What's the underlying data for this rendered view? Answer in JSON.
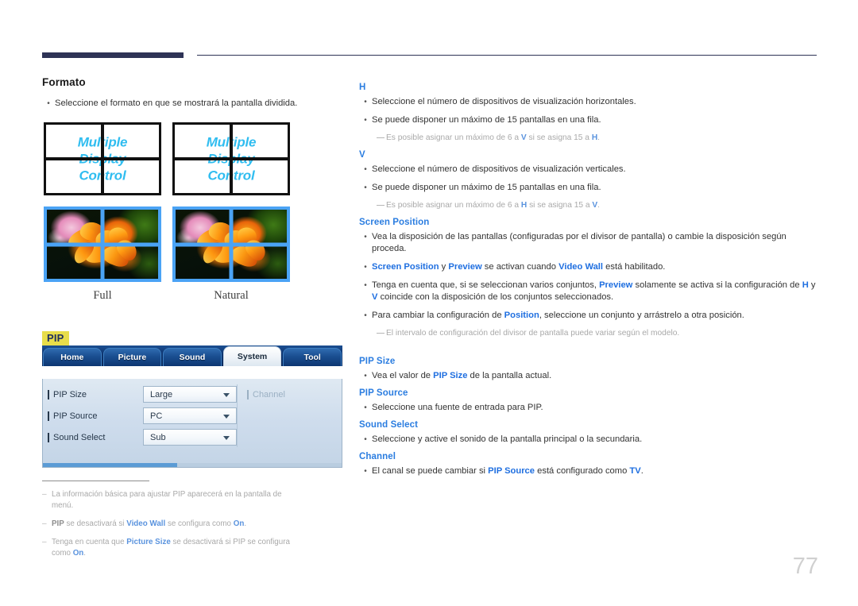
{
  "page": {
    "number": "77"
  },
  "left": {
    "section_title": "Formato",
    "intro_bullet": "Seleccione el formato en que se mostrará la pantalla dividida.",
    "wall_caption_lines": [
      "Multiple",
      "Display",
      "Control"
    ],
    "samples": [
      {
        "caption": "Full"
      },
      {
        "caption": "Natural"
      }
    ],
    "pip_tag": "PIP",
    "osd": {
      "tabs": [
        {
          "label": "Home",
          "active": false
        },
        {
          "label": "Picture",
          "active": false
        },
        {
          "label": "Sound",
          "active": false
        },
        {
          "label": "System",
          "active": true
        },
        {
          "label": "Tool",
          "active": false
        }
      ],
      "rows_left": [
        {
          "label": "PIP Size",
          "value": "Large"
        },
        {
          "label": "PIP Source",
          "value": "PC"
        },
        {
          "label": "Sound Select",
          "value": "Sub"
        }
      ],
      "rows_right": [
        {
          "label": "Channel",
          "value": ""
        }
      ]
    },
    "footnotes": [
      {
        "dash": "–",
        "html": "La información básica para ajustar PIP aparecerá en la pantalla de menú."
      },
      {
        "dash": "–",
        "html": "<span class=\"gry-b\">PIP</span> se desactivará si <span class=\"blu-lt\">Video Wall</span> se configura como <span class=\"blu-lt\">On</span>."
      },
      {
        "dash": "–",
        "html": "Tenga en cuenta que <span class=\"blu-lt\">Picture Size</span> se desactivará si PIP se configura como <span class=\"blu-lt\">On</span>."
      }
    ]
  },
  "right": {
    "blocks": [
      {
        "heading": "H",
        "items": [
          {
            "kind": "bullet",
            "html": "Seleccione el número de dispositivos de visualización horizontales."
          },
          {
            "kind": "bullet",
            "html": "Se puede disponer un máximo de 15 pantallas en una fila."
          },
          {
            "kind": "note",
            "html": "Es posible asignar un máximo de 6 a <span class=\"blu-lt\">V</span> si se asigna 15 a <span class=\"blu-lt\">H</span>."
          }
        ]
      },
      {
        "heading": "V",
        "items": [
          {
            "kind": "bullet",
            "html": "Seleccione el número de dispositivos de visualización verticales."
          },
          {
            "kind": "bullet",
            "html": "Se puede disponer un máximo de 15 pantallas en una fila."
          },
          {
            "kind": "note",
            "html": "Es posible asignar un máximo de 6 a <span class=\"blu-lt\">H</span> si se asigna 15 a <span class=\"blu-lt\">V</span>."
          }
        ]
      },
      {
        "heading": "Screen Position",
        "items": [
          {
            "kind": "bullet",
            "html": "Vea la disposición de las pantallas (configuradas por el divisor de pantalla) o cambie la disposición según proceda."
          },
          {
            "kind": "bullet",
            "html": "<span class=\"blu\">Screen Position</span> y <span class=\"blu\">Preview</span> se activan cuando <span class=\"blu\">Video Wall</span> está habilitado."
          },
          {
            "kind": "bullet",
            "html": "Tenga en cuenta que, si se seleccionan varios conjuntos, <span class=\"blu\">Preview</span> solamente se activa si la configuración de <span class=\"blu\">H</span> y <span class=\"blu\">V</span> coincide con la disposición de los conjuntos seleccionados."
          },
          {
            "kind": "bullet",
            "html": "Para cambiar la configuración de <span class=\"blu\">Position</span>, seleccione un conjunto y arrástrelo a otra posición."
          },
          {
            "kind": "note",
            "html": "El intervalo de configuración del divisor de pantalla puede variar según el modelo."
          }
        ]
      },
      {
        "heading": "PIP Size",
        "spacer_before": true,
        "items": [
          {
            "kind": "bullet",
            "html": "Vea el valor de <span class=\"blu\">PIP Size</span> de la pantalla actual."
          }
        ]
      },
      {
        "heading": "PIP Source",
        "items": [
          {
            "kind": "bullet",
            "html": "Seleccione una fuente de entrada para PIP."
          }
        ]
      },
      {
        "heading": "Sound Select",
        "items": [
          {
            "kind": "bullet",
            "html": "Seleccione y active el sonido de la pantalla principal o la secundaria."
          }
        ]
      },
      {
        "heading": "Channel",
        "items": [
          {
            "kind": "bullet",
            "html": "El canal se puede cambiar si <span class=\"blu\">PIP Source</span> está configurado como <span class=\"blu\">TV</span>."
          }
        ]
      }
    ]
  },
  "colors": {
    "navy_rule": "#2e3356",
    "accent_blue": "#2b7de0",
    "highlight_yellow": "#e8dd4a",
    "caption_cyan": "#30bdf0",
    "wall_border_blue": "#4aa3f5"
  }
}
